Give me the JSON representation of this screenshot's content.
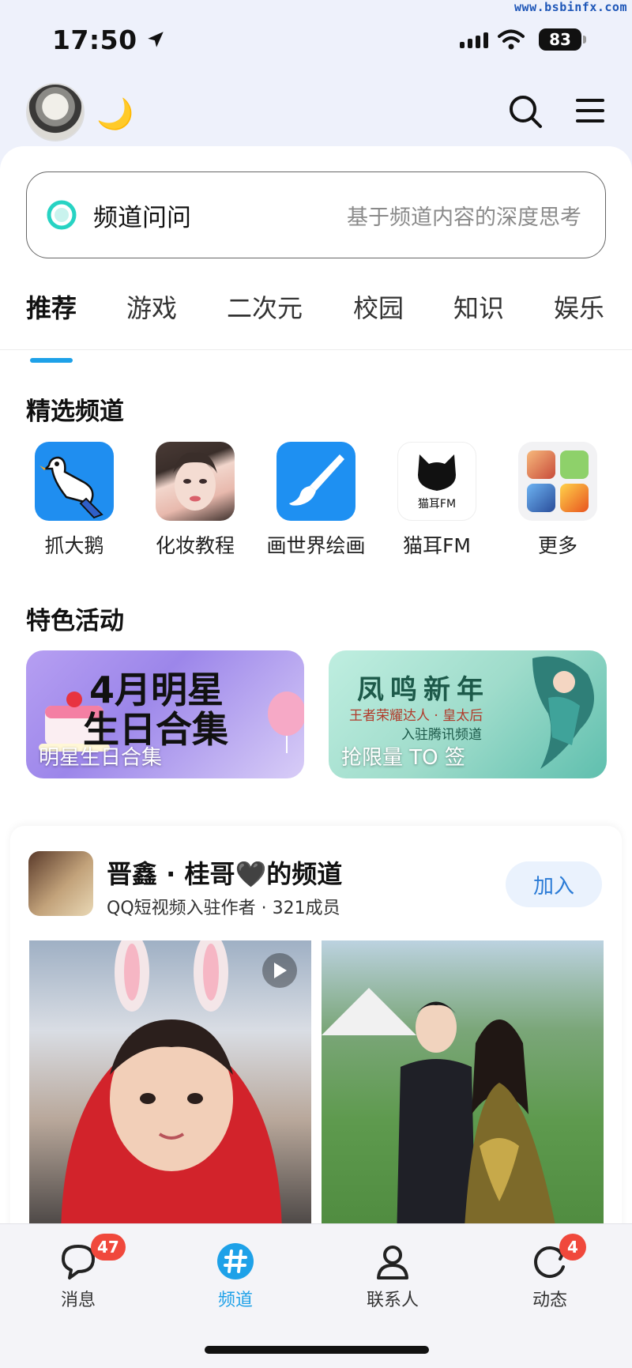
{
  "watermark": "www.bsbinfx.com",
  "status_bar": {
    "time": "17:50",
    "battery": "83"
  },
  "header": {
    "moon": "🌙"
  },
  "ask": {
    "title": "频道问问",
    "hint": "基于频道内容的深度思考"
  },
  "tabs": [
    {
      "label": "推荐",
      "active": true
    },
    {
      "label": "游戏"
    },
    {
      "label": "二次元"
    },
    {
      "label": "校园"
    },
    {
      "label": "知识"
    },
    {
      "label": "娱乐"
    }
  ],
  "featured": {
    "title": "精选频道",
    "items": [
      {
        "label": "抓大鹅",
        "icon": "goose-icon"
      },
      {
        "label": "化妆教程",
        "icon": "makeup-photo"
      },
      {
        "label": "画世界绘画",
        "icon": "brush-icon"
      },
      {
        "label": "猫耳FM",
        "icon": "cat-ear-icon",
        "icon_text": "猫耳FM"
      },
      {
        "label": "更多",
        "icon": "more-apps-icon"
      }
    ]
  },
  "activities": {
    "title": "特色活动",
    "items": [
      {
        "label": "明星生日合集",
        "art_line1": "4月明星",
        "art_line2": "生日合集"
      },
      {
        "label": "抢限量 TO 签",
        "art_line1": "凤鸣新年",
        "art_line2": "王者荣耀达人 · 皇太后",
        "art_line3": "入驻腾讯频道"
      }
    ]
  },
  "channel_card": {
    "title": "晋鑫 · 桂哥🖤的频道",
    "subtitle": "QQ短视频入驻作者 · 321成员",
    "join_label": "加入"
  },
  "bottom_nav": [
    {
      "label": "消息",
      "icon": "message-icon",
      "badge": "47"
    },
    {
      "label": "频道",
      "icon": "channel-hash-icon",
      "active": true
    },
    {
      "label": "联系人",
      "icon": "contact-icon"
    },
    {
      "label": "动态",
      "icon": "feed-icon",
      "badge": "4"
    }
  ],
  "colors": {
    "accent": "#1ea1e8",
    "badge": "#f0483c",
    "join_bg": "#eaf2fd",
    "join_text": "#2a7bd6"
  }
}
